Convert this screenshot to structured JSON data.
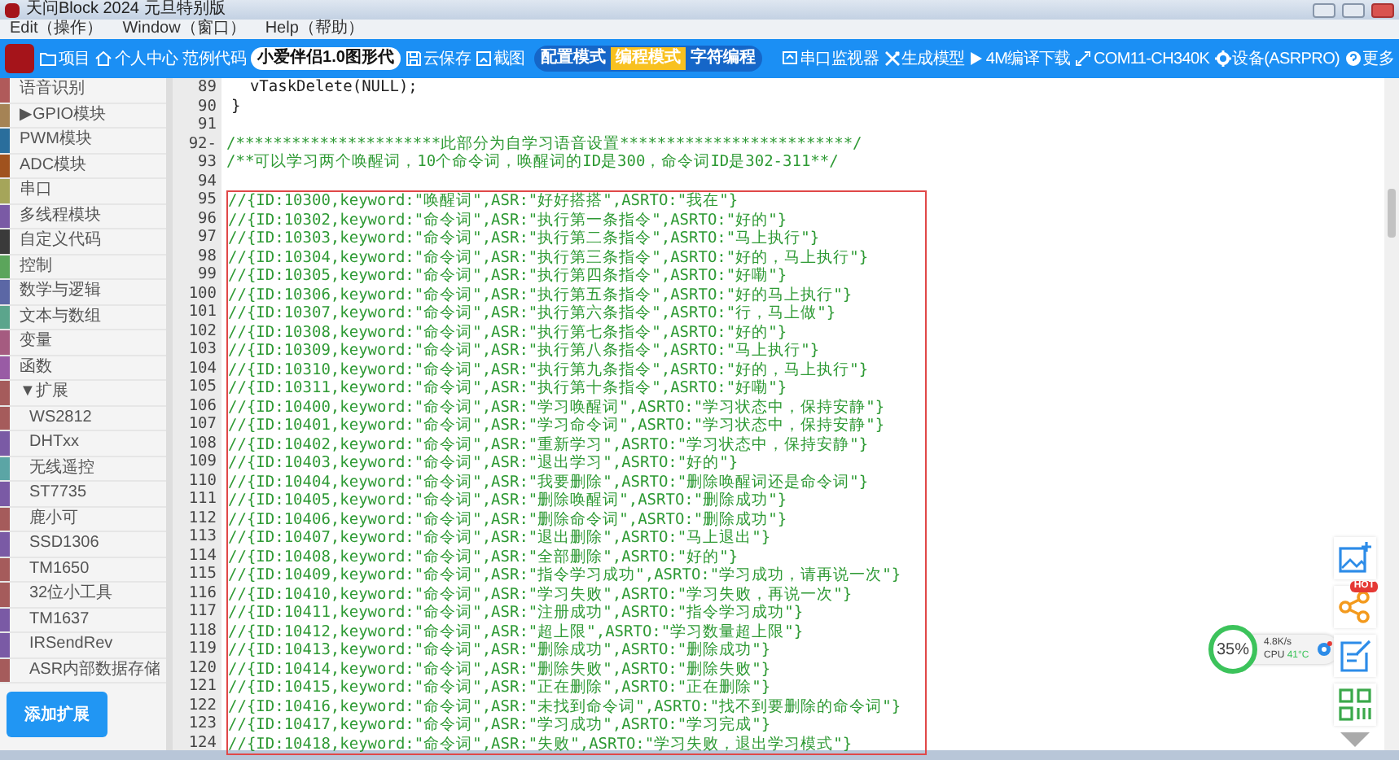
{
  "window": {
    "title": "天问Block 2024 元旦特别版",
    "controls": [
      {
        "kind": "minimize"
      },
      {
        "kind": "maximize"
      },
      {
        "kind": "close"
      }
    ]
  },
  "menu": [
    "Edit（操作）",
    "Window（窗口）",
    "Help（帮助）"
  ],
  "toolbar": {
    "left": [
      {
        "label": "项目",
        "kind": "folder"
      },
      {
        "label": "个人中心",
        "kind": "home"
      },
      {
        "label": "范例代码"
      }
    ],
    "project_name": "小爱伴侣1.0图形代",
    "actions": [
      {
        "label": "云保存",
        "kind": "disk"
      },
      {
        "label": "截图",
        "kind": "crop"
      }
    ],
    "modes": [
      {
        "label": "配置模式",
        "selected": false
      },
      {
        "label": "编程模式",
        "selected": true
      },
      {
        "label": "字符编程",
        "selected": false
      }
    ],
    "right": [
      {
        "label": "串口监视器",
        "kind": "monitor"
      },
      {
        "label": "生成模型",
        "kind": "tools"
      },
      {
        "label": "4M编译下载",
        "kind": "play"
      },
      {
        "label": "COM11-CH340K",
        "kind": "link"
      },
      {
        "label": "设备(ASRPRO)",
        "kind": "gear"
      },
      {
        "label": "更多",
        "kind": "help"
      }
    ]
  },
  "sidebar": {
    "items": [
      {
        "label": "语音识别",
        "color": "#b05a5a"
      },
      {
        "label": "GPIO模块",
        "color": "#a58355",
        "expander": "▶"
      },
      {
        "label": "PWM模块",
        "color": "#2a6e9c"
      },
      {
        "label": "ADC模块",
        "color": "#a0521e"
      },
      {
        "label": "串口",
        "color": "#a5a55a"
      },
      {
        "label": "多线程模块",
        "color": "#7a5aa5"
      },
      {
        "label": "自定义代码",
        "color": "#3a3a3a"
      },
      {
        "label": "控制",
        "color": "#5ba55b"
      },
      {
        "label": "数学与逻辑",
        "color": "#5b67a5"
      },
      {
        "label": "文本与数组",
        "color": "#5ba58c"
      },
      {
        "label": "变量",
        "color": "#a55b80"
      },
      {
        "label": "函数",
        "color": "#995ba5"
      },
      {
        "label": "扩展",
        "color": "#a55b5b",
        "expander": "▼"
      },
      {
        "label": "WS2812",
        "color": "#a55b5b",
        "sub": true
      },
      {
        "label": "DHTxx",
        "color": "#7a5aa5",
        "sub": true
      },
      {
        "label": "无线遥控",
        "color": "#5ba5a5",
        "sub": true
      },
      {
        "label": "ST7735",
        "color": "#7a5aa5",
        "sub": true
      },
      {
        "label": "鹿小可",
        "color": "#a55b5b",
        "sub": true
      },
      {
        "label": "SSD1306",
        "color": "#7a5aa5",
        "sub": true
      },
      {
        "label": "TM1650",
        "color": "#a55b5b",
        "sub": true
      },
      {
        "label": "32位小工具",
        "color": "#a55b5b",
        "sub": true
      },
      {
        "label": "TM1637",
        "color": "#7a5aa5",
        "sub": true
      },
      {
        "label": "IRSendRev",
        "color": "#7a5aa5",
        "sub": true
      },
      {
        "label": "ASR内部数据存储",
        "color": "#a55b5b",
        "sub": true
      }
    ],
    "add_button": "添加扩展"
  },
  "editor": {
    "lines": [
      {
        "number": "89",
        "text": "  vTaskDelete(NULL);",
        "kind": "code"
      },
      {
        "number": "90",
        "text": "}",
        "kind": "code"
      },
      {
        "number": "91"
      },
      {
        "number": "92",
        "marker": "-",
        "text": "/**********************此部分为自学习语音设置*************************/",
        "kind": "comment"
      },
      {
        "number": "93",
        "text": "/**可以学习两个唤醒词，10个命令词，唤醒词的ID是300，命令词ID是302-311**/",
        "kind": "comment"
      },
      {
        "number": "94"
      }
    ],
    "boxed_lines": [
      {
        "number": "95",
        "text": "//{ID:10300,keyword:\"唤醒词\",ASR:\"好好搭搭\",ASRTO:\"我在\"}",
        "kind": "comment"
      },
      {
        "number": "96",
        "text": "//{ID:10302,keyword:\"命令词\",ASR:\"执行第一条指令\",ASRTO:\"好的\"}",
        "kind": "comment"
      },
      {
        "number": "97",
        "text": "//{ID:10303,keyword:\"命令词\",ASR:\"执行第二条指令\",ASRTO:\"马上执行\"}",
        "kind": "comment"
      },
      {
        "number": "98",
        "text": "//{ID:10304,keyword:\"命令词\",ASR:\"执行第三条指令\",ASRTO:\"好的，马上执行\"}",
        "kind": "comment"
      },
      {
        "number": "99",
        "text": "//{ID:10305,keyword:\"命令词\",ASR:\"执行第四条指令\",ASRTO:\"好嘞\"}",
        "kind": "comment"
      },
      {
        "number": "100",
        "text": "//{ID:10306,keyword:\"命令词\",ASR:\"执行第五条指令\",ASRTO:\"好的马上执行\"}",
        "kind": "comment"
      },
      {
        "number": "101",
        "text": "//{ID:10307,keyword:\"命令词\",ASR:\"执行第六条指令\",ASRTO:\"行，马上做\"}",
        "kind": "comment"
      },
      {
        "number": "102",
        "text": "//{ID:10308,keyword:\"命令词\",ASR:\"执行第七条指令\",ASRTO:\"好的\"}",
        "kind": "comment"
      },
      {
        "number": "103",
        "text": "//{ID:10309,keyword:\"命令词\",ASR:\"执行第八条指令\",ASRTO:\"马上执行\"}",
        "kind": "comment"
      },
      {
        "number": "104",
        "text": "//{ID:10310,keyword:\"命令词\",ASR:\"执行第九条指令\",ASRTO:\"好的，马上执行\"}",
        "kind": "comment"
      },
      {
        "number": "105",
        "text": "//{ID:10311,keyword:\"命令词\",ASR:\"执行第十条指令\",ASRTO:\"好嘞\"}",
        "kind": "comment"
      },
      {
        "number": "106",
        "text": "//{ID:10400,keyword:\"命令词\",ASR:\"学习唤醒词\",ASRTO:\"学习状态中，保持安静\"}",
        "kind": "comment"
      },
      {
        "number": "107",
        "text": "//{ID:10401,keyword:\"命令词\",ASR:\"学习命令词\",ASRTO:\"学习状态中，保持安静\"}",
        "kind": "comment"
      },
      {
        "number": "108",
        "text": "//{ID:10402,keyword:\"命令词\",ASR:\"重新学习\",ASRTO:\"学习状态中，保持安静\"}",
        "kind": "comment"
      },
      {
        "number": "109",
        "text": "//{ID:10403,keyword:\"命令词\",ASR:\"退出学习\",ASRTO:\"好的\"}",
        "kind": "comment"
      },
      {
        "number": "110",
        "text": "//{ID:10404,keyword:\"命令词\",ASR:\"我要删除\",ASRTO:\"删除唤醒词还是命令词\"}",
        "kind": "comment"
      },
      {
        "number": "111",
        "text": "//{ID:10405,keyword:\"命令词\",ASR:\"删除唤醒词\",ASRTO:\"删除成功\"}",
        "kind": "comment"
      },
      {
        "number": "112",
        "text": "//{ID:10406,keyword:\"命令词\",ASR:\"删除命令词\",ASRTO:\"删除成功\"}",
        "kind": "comment"
      },
      {
        "number": "113",
        "text": "//{ID:10407,keyword:\"命令词\",ASR:\"退出删除\",ASRTO:\"马上退出\"}",
        "kind": "comment"
      },
      {
        "number": "114",
        "text": "//{ID:10408,keyword:\"命令词\",ASR:\"全部删除\",ASRTO:\"好的\"}",
        "kind": "comment"
      },
      {
        "number": "115",
        "text": "//{ID:10409,keyword:\"命令词\",ASR:\"指令学习成功\",ASRTO:\"学习成功，请再说一次\"}",
        "kind": "comment"
      },
      {
        "number": "116",
        "text": "//{ID:10410,keyword:\"命令词\",ASR:\"学习失败\",ASRTO:\"学习失败，再说一次\"}",
        "kind": "comment"
      },
      {
        "number": "117",
        "text": "//{ID:10411,keyword:\"命令词\",ASR:\"注册成功\",ASRTO:\"指令学习成功\"}",
        "kind": "comment"
      },
      {
        "number": "118",
        "text": "//{ID:10412,keyword:\"命令词\",ASR:\"超上限\",ASRTO:\"学习数量超上限\"}",
        "kind": "comment"
      },
      {
        "number": "119",
        "text": "//{ID:10413,keyword:\"命令词\",ASR:\"删除成功\",ASRTO:\"删除成功\"}",
        "kind": "comment"
      },
      {
        "number": "120",
        "text": "//{ID:10414,keyword:\"命令词\",ASR:\"删除失败\",ASRTO:\"删除失败\"}",
        "kind": "comment"
      },
      {
        "number": "121",
        "text": "//{ID:10415,keyword:\"命令词\",ASR:\"正在删除\",ASRTO:\"正在删除\"}",
        "kind": "comment"
      },
      {
        "number": "122",
        "text": "//{ID:10416,keyword:\"命令词\",ASR:\"未找到命令词\",ASRTO:\"找不到要删除的命令词\"}",
        "kind": "comment"
      },
      {
        "number": "123",
        "text": "//{ID:10417,keyword:\"命令词\",ASR:\"学习成功\",ASRTO:\"学习完成\"}",
        "kind": "comment"
      },
      {
        "number": "124",
        "text": "//{ID:10418,keyword:\"命令词\",ASR:\"失败\",ASRTO:\"学习失败，退出学习模式\"}",
        "kind": "comment"
      }
    ]
  },
  "monitor": {
    "percent": "35%",
    "speed": "4.8K/s",
    "cpu_label": "CPU",
    "cpu_temp": "41°C"
  },
  "floating_tools": [
    {
      "kind": "image-add"
    },
    {
      "kind": "share",
      "badge": "HOT"
    },
    {
      "kind": "note"
    },
    {
      "kind": "qr"
    }
  ]
}
